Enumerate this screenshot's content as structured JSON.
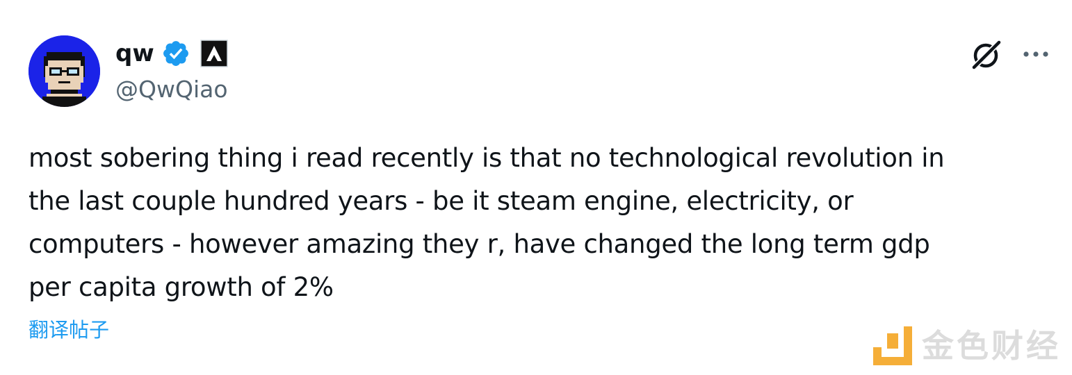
{
  "author": {
    "display_name": "qw",
    "handle": "@QwQiao",
    "verified_icon": "verified-badge-icon",
    "affiliate_icon": "affiliate-badge-icon",
    "avatar_bg": "#1b23e8"
  },
  "actions": {
    "grok_icon": "grok-icon",
    "more_icon": "more-dots-icon"
  },
  "tweet": {
    "lines": [
      "most sobering thing i read recently is that no technological revolution in",
      "the last couple hundred years - be it steam engine, electricity, or",
      "computers - however amazing they r, have changed the long term gdp",
      "per capita growth of 2%"
    ],
    "translate_label": "翻译帖子"
  },
  "watermark": {
    "text": "金色财经",
    "logo_color": "#f5a623"
  },
  "colors": {
    "text": "#0f1419",
    "secondary": "#536471",
    "link": "#1d9bf0",
    "verified": "#1d9bf0"
  }
}
